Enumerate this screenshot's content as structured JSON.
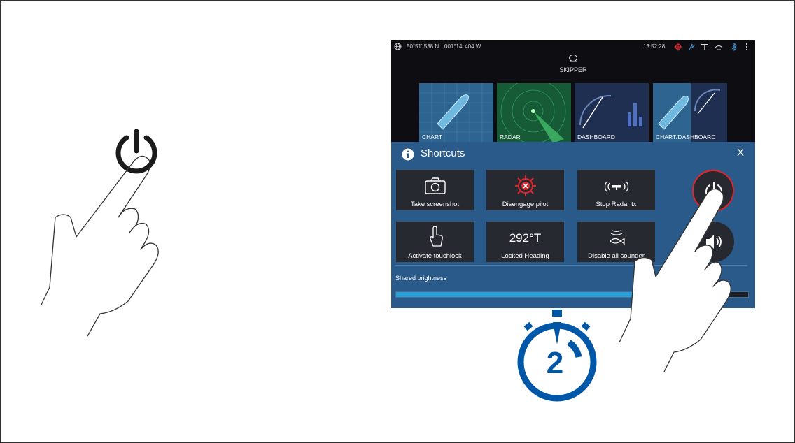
{
  "statusbar": {
    "latitude": "50°51'.538 N",
    "longitude": "001°14'.404 W",
    "time": "13:52:28"
  },
  "profile": {
    "name": "SKIPPER"
  },
  "app_tiles": [
    {
      "label": "CHART"
    },
    {
      "label": "RADAR"
    },
    {
      "label": "DASHBOARD"
    },
    {
      "label": "CHART/DASHBOARD"
    }
  ],
  "shortcuts": {
    "title": "Shortcuts",
    "close": "X",
    "buttons": [
      {
        "label": "Take screenshot",
        "icon": "camera-icon"
      },
      {
        "label": "Disengage pilot",
        "icon": "disengage-pilot-icon"
      },
      {
        "label": "Stop Radar tx",
        "icon": "radar-transmit-icon"
      },
      {
        "label": "Activate touchlock",
        "icon": "touch-hand-icon"
      },
      {
        "label": "Locked Heading",
        "value": "292°T"
      },
      {
        "label": "Disable all sounder",
        "icon": "sounder-fish-icon"
      }
    ],
    "brightness_label": "Shared brightness",
    "brightness_level": 0.68
  },
  "timer": {
    "seconds": "2"
  },
  "colors": {
    "accent_blue": "#0057a8",
    "panel_blue": "#2a5a8a",
    "alert_red": "#e0242b"
  }
}
